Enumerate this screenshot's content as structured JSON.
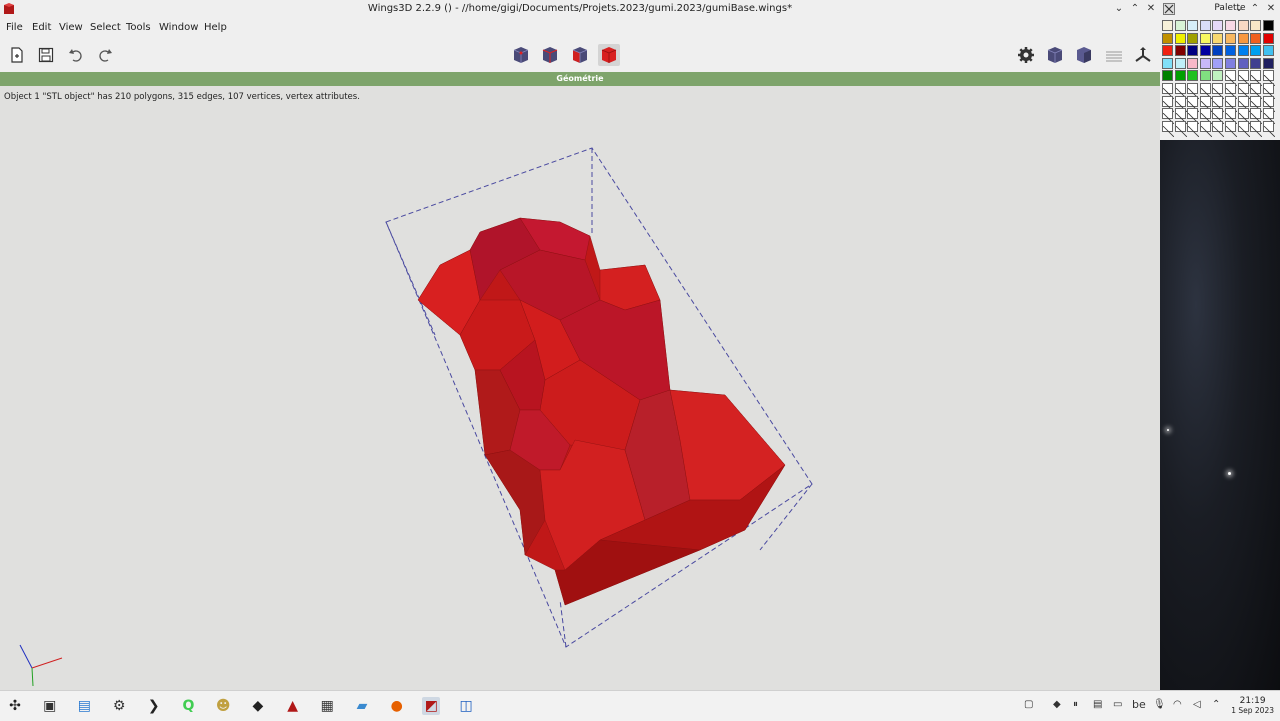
{
  "window": {
    "title": "Wings3D 2.2.9 () - //home/gigi/Documents/Projets.2023/gumi.2023/gumiBase.wings*",
    "controls": [
      "⌄",
      "⌃",
      "✕",
      "⌄"
    ]
  },
  "menu": {
    "items": [
      "File",
      "Edit",
      "View",
      "Select",
      "Tools",
      "Window",
      "Help"
    ]
  },
  "toolbar": {
    "left_icons": [
      "new-file-icon",
      "save-icon",
      "undo-icon",
      "redo-icon"
    ],
    "mode_icons": [
      "vertex-mode-icon",
      "edge-mode-icon",
      "face-mode-icon",
      "body-mode-icon"
    ],
    "right_icons": [
      "settings-gear-icon",
      "cube-view-icon",
      "cube-shaded-icon",
      "ground-plane-icon",
      "axes-icon"
    ]
  },
  "geometry_bar": {
    "label": "Géométrie"
  },
  "status": {
    "info": "Object 1 \"STL object\" has 210 polygons, 315 edges, 107 vertices, vertex attributes."
  },
  "palette": {
    "title": "Palette",
    "controls": [
      "⌄",
      "⌃",
      "✕"
    ],
    "colors": [
      "#f7f1d9",
      "#d8f3d6",
      "#d6eef8",
      "#d9def8",
      "#e6d9f8",
      "#f8d9e6",
      "#f8d9c4",
      "#f8e7c8",
      "#000000",
      "#c09000",
      "#f0f000",
      "#a0a000",
      "#f8f860",
      "#f8d870",
      "#f8b860",
      "#f89840",
      "#f06020",
      "#e00000",
      "#f02010",
      "#800000",
      "#000080",
      "#0000a0",
      "#0040c0",
      "#0060e0",
      "#0080f0",
      "#00a0f0",
      "#40c0f0",
      "#80e0f8",
      "#c0f0f8",
      "#f8b8c8",
      "#c8b8f8",
      "#a0a0f8",
      "#8080e0",
      "#6060c0",
      "#404090",
      "#202060",
      "#008000",
      "#00a000",
      "#20c020",
      "#80e080",
      "#c0f0c0"
    ]
  },
  "taskbar": {
    "apps": [
      "launcher-icon",
      "terminal-icon",
      "files-icon",
      "settings-icon",
      "console-icon",
      "qt-creator-icon",
      "gimp-icon",
      "inkscape-icon",
      "wings-icon",
      "calculator-icon",
      "folder-icon",
      "firefox-icon",
      "wings3d-active-icon",
      "wireshark-icon"
    ],
    "tray_lang": "be",
    "time": "21:19",
    "date": "1 Sep 2023"
  }
}
